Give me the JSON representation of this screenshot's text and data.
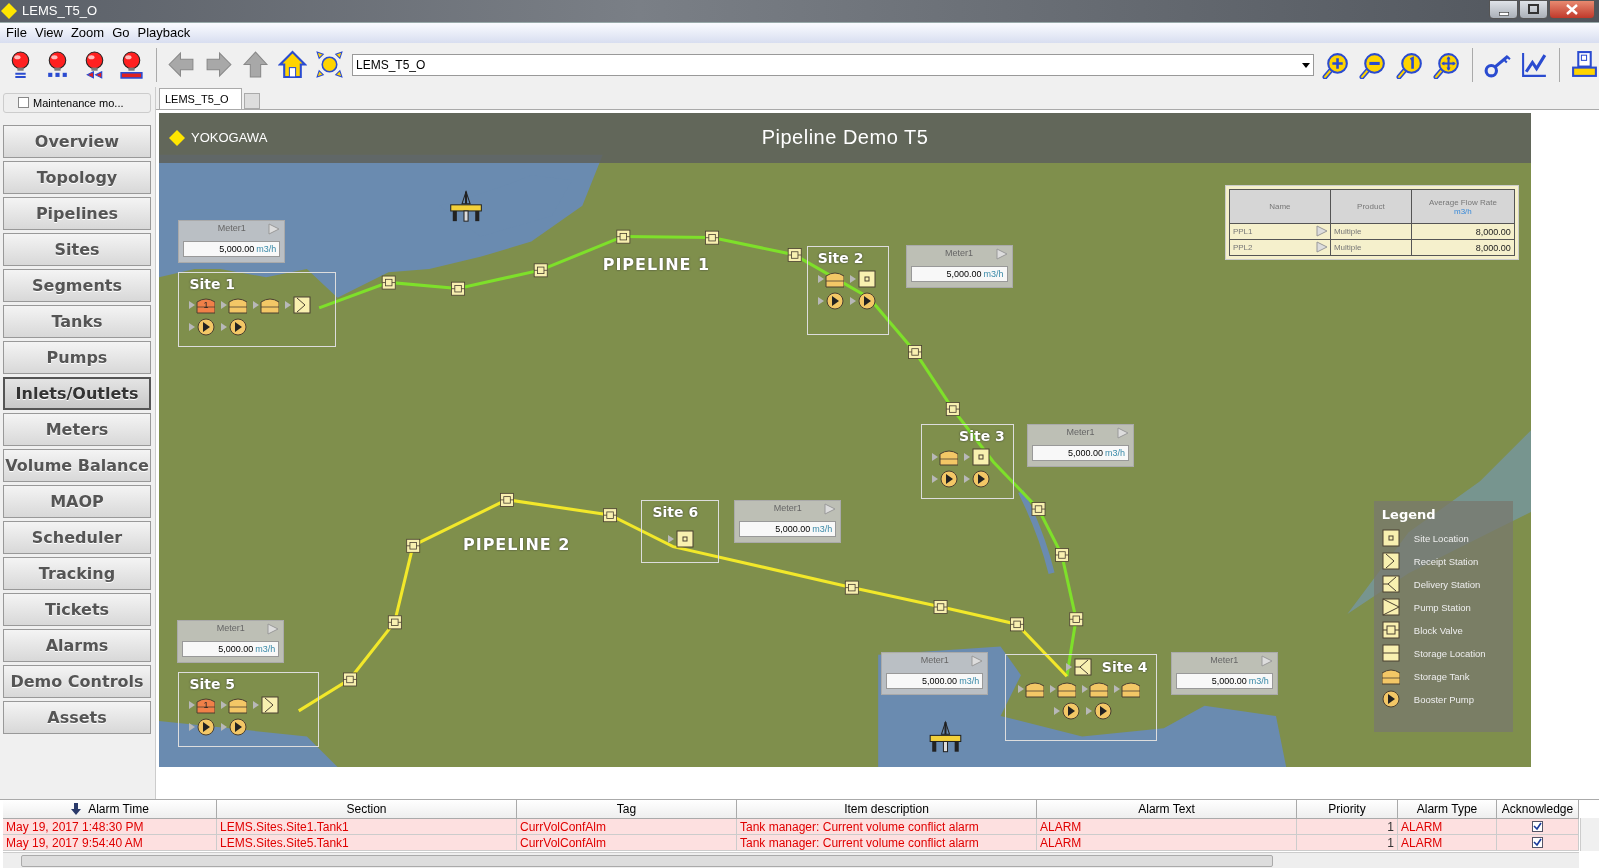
{
  "window": {
    "title": "LEMS_T5_O"
  },
  "menu": [
    "File",
    "View",
    "Zoom",
    "Go",
    "Playback"
  ],
  "toolbar": {
    "address": "LEMS_T5_O"
  },
  "maintenance": {
    "label": "Maintenance mo...",
    "checked": false
  },
  "nav": {
    "items": [
      {
        "label": "Overview",
        "selected": false
      },
      {
        "label": "Topology",
        "selected": false
      },
      {
        "label": "Pipelines",
        "selected": false
      },
      {
        "label": "Sites",
        "selected": false
      },
      {
        "label": "Segments",
        "selected": false
      },
      {
        "label": "Tanks",
        "selected": false
      },
      {
        "label": "Pumps",
        "selected": false
      },
      {
        "label": "Inlets/Outlets",
        "selected": true
      },
      {
        "label": "Meters",
        "selected": false
      },
      {
        "label": "Volume Balance",
        "selected": false
      },
      {
        "label": "MAOP",
        "selected": false
      },
      {
        "label": "Scheduler",
        "selected": false
      },
      {
        "label": "Tracking",
        "selected": false
      },
      {
        "label": "Tickets",
        "selected": false
      },
      {
        "label": "Alarms",
        "selected": false
      },
      {
        "label": "Demo Controls",
        "selected": false
      },
      {
        "label": "Assets",
        "selected": false
      }
    ]
  },
  "tabs": [
    {
      "label": "LEMS_T5_O",
      "selected": true
    }
  ],
  "map": {
    "brand": "YOKOGAWA",
    "title": "Pipeline Demo T5",
    "pipelines": [
      {
        "label": "PIPELINE 1",
        "color": "#7ee02a"
      },
      {
        "label": "PIPELINE 2",
        "color": "#f2e82a"
      }
    ],
    "sites": [
      {
        "name": "Site 1",
        "rows": [
          [
            {
              "kind": "tank",
              "alarm": true,
              "badge": "1"
            },
            {
              "kind": "tank",
              "alarm": false
            },
            {
              "kind": "tank",
              "alarm": false
            },
            {
              "kind": "receipt"
            }
          ],
          [
            {
              "kind": "pump"
            },
            {
              "kind": "pump"
            }
          ]
        ]
      },
      {
        "name": "Site 2",
        "rows": [
          [
            {
              "kind": "tank",
              "alarm": false
            },
            {
              "kind": "location"
            }
          ],
          [
            {
              "kind": "pump"
            },
            {
              "kind": "pump"
            }
          ]
        ]
      },
      {
        "name": "Site 3",
        "rows": [
          [
            {
              "kind": "tank",
              "alarm": false
            },
            {
              "kind": "location"
            }
          ],
          [
            {
              "kind": "pump"
            },
            {
              "kind": "pump"
            }
          ]
        ]
      },
      {
        "name": "Site 4",
        "rows": [
          [
            {
              "kind": "delivery"
            }
          ],
          [
            {
              "kind": "tank",
              "alarm": false
            },
            {
              "kind": "tank",
              "alarm": false
            },
            {
              "kind": "tank",
              "alarm": false
            },
            {
              "kind": "tank",
              "alarm": false
            }
          ],
          [
            {
              "kind": "pump"
            },
            {
              "kind": "pump"
            }
          ]
        ]
      },
      {
        "name": "Site 5",
        "rows": [
          [
            {
              "kind": "tank",
              "alarm": true,
              "badge": "1"
            },
            {
              "kind": "tank",
              "alarm": false
            },
            {
              "kind": "receipt"
            }
          ],
          [
            {
              "kind": "pump"
            },
            {
              "kind": "pump"
            }
          ]
        ]
      },
      {
        "name": "Site 6",
        "rows": [
          [
            {
              "kind": "location"
            }
          ]
        ]
      }
    ],
    "meters": [
      {
        "name": "Meter1",
        "value": "5,000.00",
        "unit": "m3/h"
      },
      {
        "name": "Meter1",
        "value": "5,000.00",
        "unit": "m3/h"
      },
      {
        "name": "Meter1",
        "value": "5,000.00",
        "unit": "m3/h"
      },
      {
        "name": "Meter1",
        "value": "5,000.00",
        "unit": "m3/h"
      },
      {
        "name": "Meter1",
        "value": "5,000.00",
        "unit": "m3/h"
      },
      {
        "name": "Meter1",
        "value": "5,000.00",
        "unit": "m3/h"
      },
      {
        "name": "Meter1",
        "value": "5,000.00",
        "unit": "m3/h"
      }
    ],
    "summary": {
      "columns": [
        "Name",
        "Product",
        "Average Flow Rate"
      ],
      "unit": "m3/h",
      "rows": [
        {
          "name": "PPL1",
          "product": "Multiple",
          "rate": "8,000.00"
        },
        {
          "name": "PPL2",
          "product": "Multiple",
          "rate": "8,000.00"
        }
      ]
    },
    "legend": {
      "title": "Legend",
      "items": [
        {
          "kind": "location",
          "label": "Site Location"
        },
        {
          "kind": "receipt",
          "label": "Receipt Station"
        },
        {
          "kind": "delivery",
          "label": "Delivery Station"
        },
        {
          "kind": "pump_station",
          "label": "Pump Station"
        },
        {
          "kind": "valve",
          "label": "Block Valve"
        },
        {
          "kind": "storage",
          "label": "Storage Location"
        },
        {
          "kind": "tank",
          "label": "Storage Tank"
        },
        {
          "kind": "pump",
          "label": "Booster Pump"
        }
      ]
    }
  },
  "alarms": {
    "columns": [
      "Alarm Time",
      "Section",
      "Tag",
      "Item description",
      "Alarm Text",
      "Priority",
      "Alarm Type",
      "Acknowledge"
    ],
    "rows": [
      {
        "time": "May 19, 2017 1:48:30 PM",
        "section": "LEMS.Sites.Site1.Tank1",
        "tag": "CurrVolConfAlm",
        "description": "Tank manager: Current volume conflict alarm",
        "text": "ALARM",
        "priority": "1",
        "type": "ALARM",
        "acknowledged": true
      },
      {
        "time": "May 19, 2017 9:54:40 AM",
        "section": "LEMS.Sites.Site5.Tank1",
        "tag": "CurrVolConfAlm",
        "description": "Tank manager: Current volume conflict alarm",
        "text": "ALARM",
        "priority": "1",
        "type": "ALARM",
        "acknowledged": true
      }
    ]
  }
}
